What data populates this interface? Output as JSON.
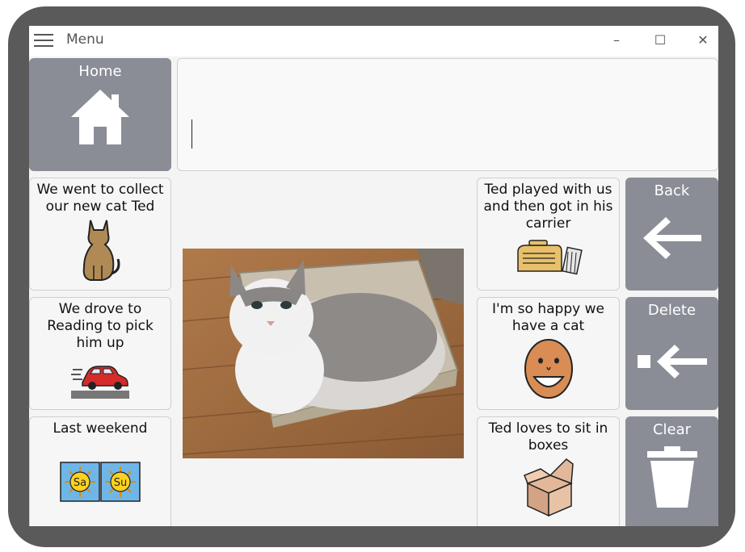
{
  "window": {
    "menu_label": "Menu",
    "minimize_glyph": "–",
    "maximize_glyph": "☐",
    "close_glyph": "✕"
  },
  "message_bar": {
    "value": ""
  },
  "nav": {
    "home": "Home",
    "back": "Back",
    "delete": "Delete",
    "clear": "Clear"
  },
  "left_tiles": [
    {
      "label": "We went to collect our new cat Ted",
      "icon": "cat-icon"
    },
    {
      "label": "We drove to Reading to pick him up",
      "icon": "car-icon"
    },
    {
      "label": "Last weekend",
      "icon": "weekend-calendar-icon"
    }
  ],
  "right_tiles": [
    {
      "label": "Ted played with us and then got in his carrier",
      "icon": "pet-carrier-icon"
    },
    {
      "label": "I'm so happy we have a cat",
      "icon": "happy-face-icon"
    },
    {
      "label": "Ted loves to sit in boxes",
      "icon": "box-icon"
    }
  ],
  "calendar_days": [
    "Sa",
    "Su"
  ],
  "photo": {
    "subject": "cat-in-box-photo"
  },
  "colors": {
    "nav_button": "#8a8d96",
    "frame": "#5a5a5a",
    "tile_bg": "#f6f6f6"
  }
}
